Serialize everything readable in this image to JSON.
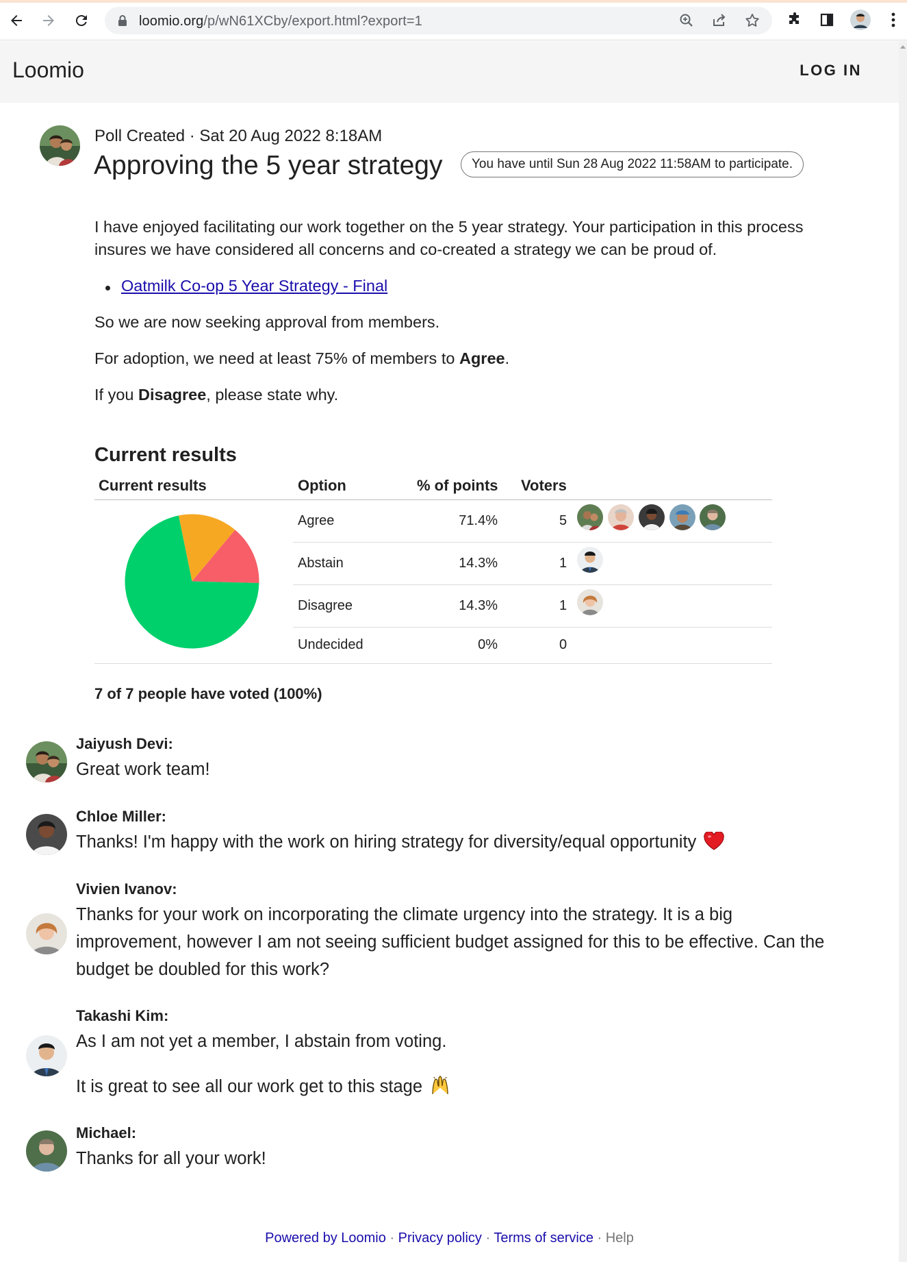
{
  "browser": {
    "url_host": "loomio.org",
    "url_path": "/p/wN61XCby/export.html?export=1"
  },
  "app": {
    "brand": "Loomio",
    "login_label": "LOG IN"
  },
  "poll": {
    "meta": "Poll Created · Sat 20 Aug 2022 8:18AM",
    "title": "Approving the 5 year strategy",
    "deadline": "You have until Sun 28 Aug 2022 11:58AM to participate.",
    "intro_line1": "I have enjoyed facilitating our work together on the 5 year strategy. Your participation in this process",
    "intro_line2": "insures we have considered all concerns and co-created a strategy we can be proud of.",
    "link_text": "Oatmilk Co-op 5 Year Strategy - Final",
    "seeking": "So we are now seeking approval from members.",
    "adoption_pre": "For adoption, we need at least 75% of members to ",
    "adoption_bold": "Agree",
    "adoption_post": ".",
    "disagree_pre": "If you ",
    "disagree_bold": "Disagree",
    "disagree_post": ", please state why."
  },
  "results": {
    "heading": "Current results",
    "columns": [
      "Current results",
      "Option",
      "% of points",
      "Voters"
    ],
    "rows": [
      {
        "option": "Agree",
        "percent": "71.4%",
        "voters": "5"
      },
      {
        "option": "Abstain",
        "percent": "14.3%",
        "voters": "1"
      },
      {
        "option": "Disagree",
        "percent": "14.3%",
        "voters": "1"
      },
      {
        "option": "Undecided",
        "percent": "0%",
        "voters": "0"
      }
    ],
    "voted_summary": "7 of 7 people have voted (100%)"
  },
  "chart_data": {
    "type": "pie",
    "categories": [
      "Agree",
      "Abstain",
      "Disagree",
      "Undecided"
    ],
    "values": [
      71.4,
      14.3,
      14.3,
      0
    ],
    "colors": [
      "#00d06b",
      "#f6a823",
      "#f75e67",
      "#cccccc"
    ],
    "title": "Current results"
  },
  "comments": [
    {
      "name": "Jaiyush Devi:",
      "lines": [
        "Great work team!"
      ]
    },
    {
      "name": "Chloe Miller:",
      "lines": [
        "Thanks! I'm happy with the work on hiring strategy for diversity/equal opportunity"
      ]
    },
    {
      "name": "Vivien Ivanov:",
      "lines": [
        "Thanks for your work on incorporating the climate urgency into the strategy. It is a big",
        "improvement, however I am not seeing sufficient budget assigned for this to be effective. Can the",
        "budget be doubled for this work?"
      ]
    },
    {
      "name": "Takashi Kim:",
      "lines": [
        "As I am not yet a member, I abstain from voting.",
        "It is great to see all our work get to this stage"
      ]
    },
    {
      "name": "Michael:",
      "lines": [
        "Thanks for all your work!"
      ]
    }
  ],
  "footer": {
    "powered": "Powered by Loomio",
    "privacy": "Privacy policy",
    "terms": "Terms of service",
    "help": "Help",
    "sep": " · "
  }
}
